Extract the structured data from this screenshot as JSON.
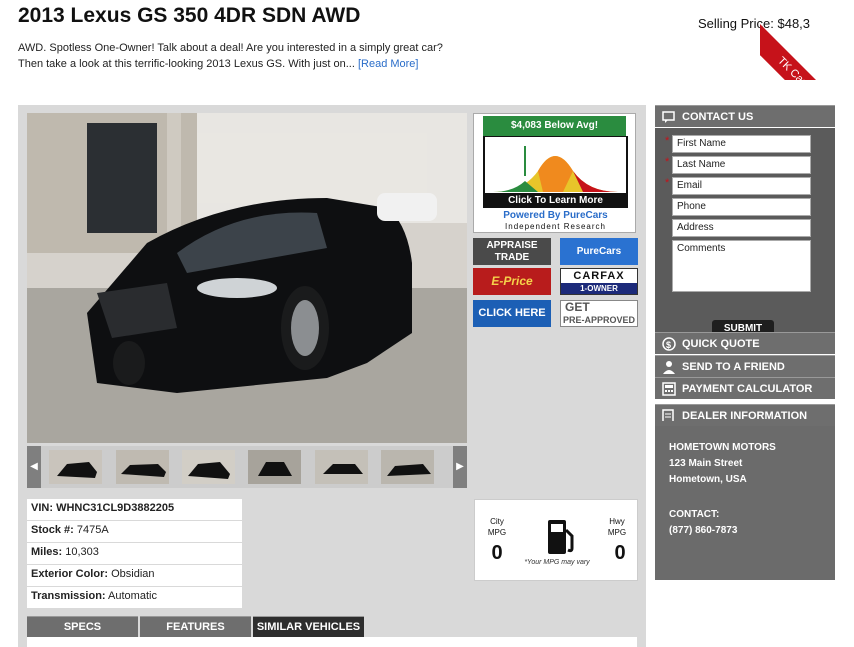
{
  "vehicle": {
    "title": "2013 Lexus GS 350 4DR SDN AWD",
    "selling_price_label": "Selling Price: $48,3",
    "description": "AWD. Spotless One-Owner! Talk about a deal! Are you interested in a simply great car? Then take a look at this terrific-looking 2013 Lexus GS. With just on...",
    "read_more": "[Read More]"
  },
  "ribbon": {
    "text": "TK Carsites",
    "color": "#c6121a"
  },
  "purecars": {
    "below_avg": "$4,083 Below Avg!",
    "cta": "Click To Learn More",
    "powered": "Powered By PureCars",
    "research": "Independent Research"
  },
  "badges": {
    "appraise": "APPRAISE TRADE",
    "purecars": "PureCars",
    "eprice": "E-Price",
    "carfax": "CARFAX",
    "carfax_sub": "1-OWNER",
    "click_here": "CLICK HERE",
    "get": "GET",
    "preapproved": "PRE-APPROVED"
  },
  "specs": [
    {
      "label": "VIN:",
      "value": "WHNC31CL9D3882205"
    },
    {
      "label": "Stock #:",
      "value": "7475A"
    },
    {
      "label": "Miles:",
      "value": "10,303"
    },
    {
      "label": "Exterior Color:",
      "value": "Obsidian"
    },
    {
      "label": "Transmission:",
      "value": "Automatic"
    }
  ],
  "mpg": {
    "city_label": "City",
    "hwy_label": "Hwy",
    "mpg_label": "MPG",
    "city_value": "0",
    "hwy_value": "0",
    "note": "*Your MPG may vary"
  },
  "tabs": [
    "SPECS",
    "FEATURES",
    "SIMILAR VEHICLES"
  ],
  "sidebar": {
    "contact_us": "CONTACT US",
    "fields": {
      "first_name": "First Name",
      "last_name": "Last Name",
      "email": "Email",
      "phone": "Phone",
      "address": "Address",
      "comments": "Comments"
    },
    "submit": "SUBMIT",
    "quick_quote": "QUICK QUOTE",
    "send_friend": "SEND TO A FRIEND",
    "payment_calc": "PAYMENT CALCULATOR",
    "dealer_info": "DEALER INFORMATION"
  },
  "dealer": {
    "name": "HOMETOWN MOTORS",
    "street": "123 Main Street",
    "city": "Hometown, USA",
    "contact_label": "CONTACT:",
    "phone": "(877) 860-7873"
  }
}
